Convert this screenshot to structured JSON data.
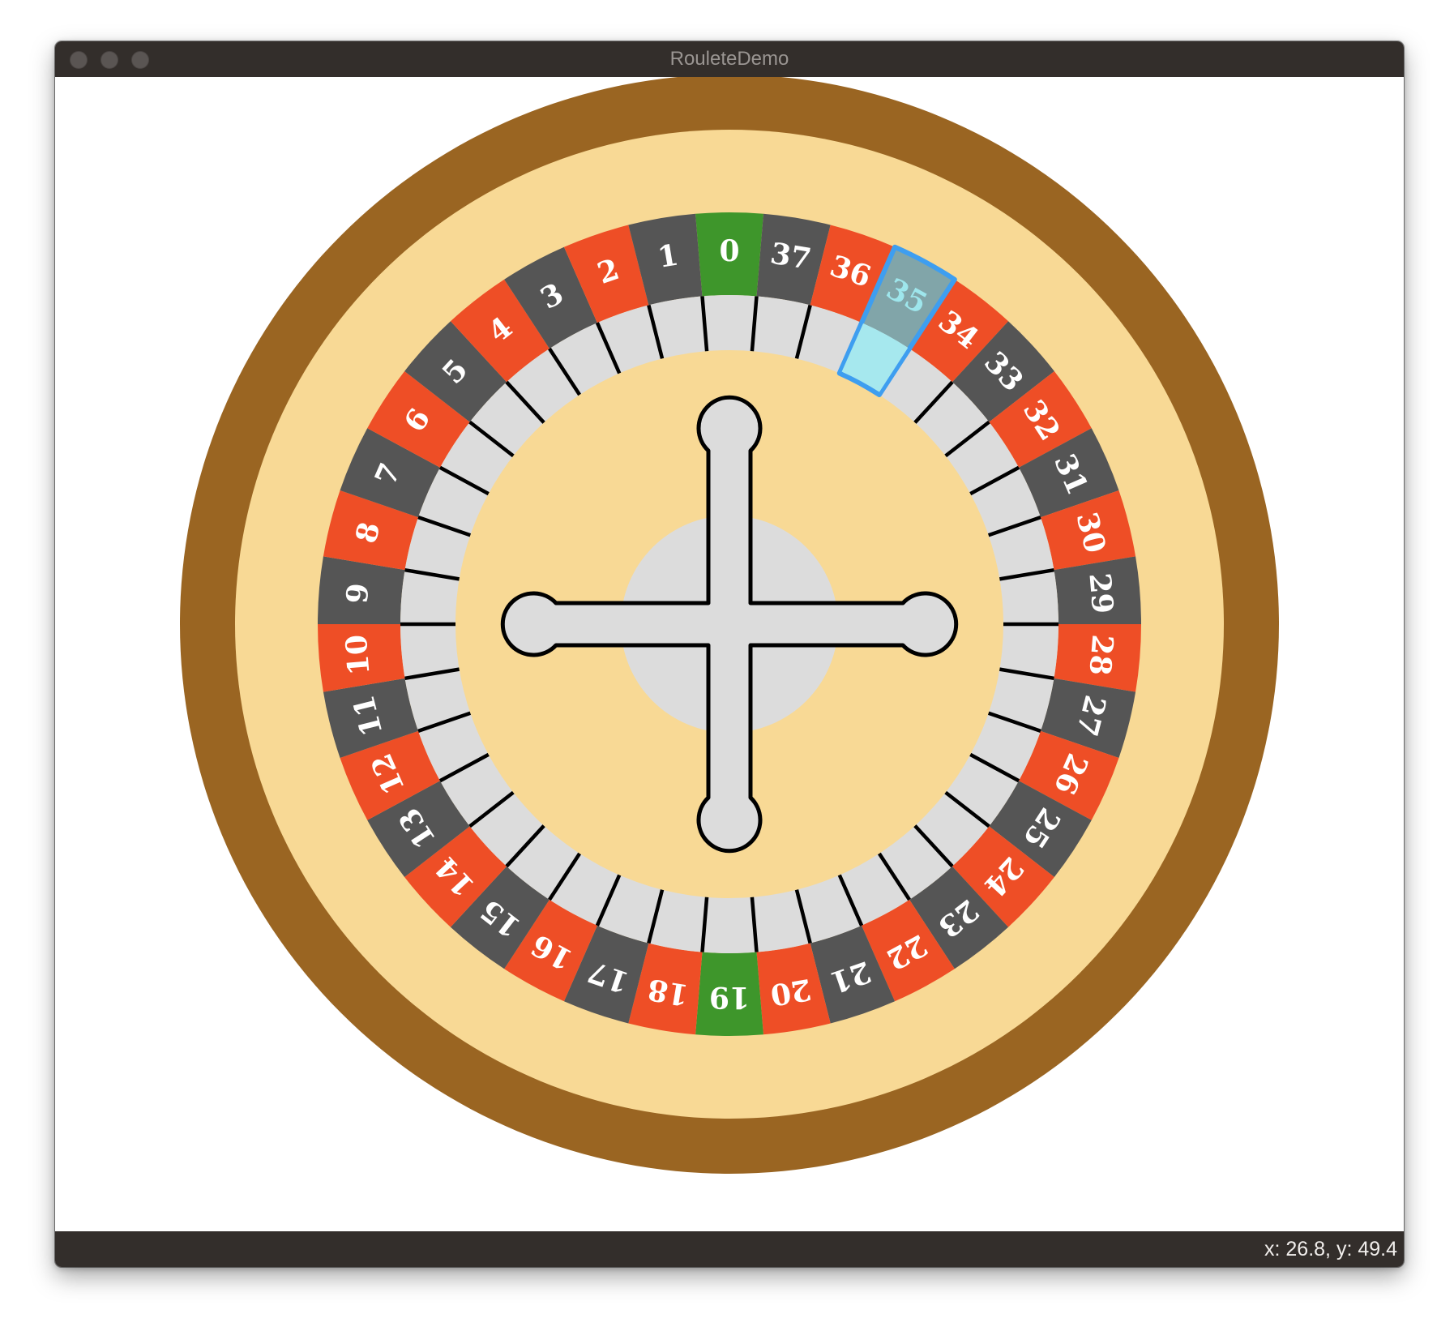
{
  "window": {
    "title": "RouleteDemo"
  },
  "status": {
    "coords": "x: 26.8, y: 49.4"
  },
  "colors": {
    "outer_rim": "#9a6522",
    "tan": "#f8d995",
    "red": "#ee4e26",
    "black": "#555555",
    "green": "#3e962b",
    "divider_track": "#dcdcdc",
    "highlight_fill": "#a6e8ee",
    "highlight_stroke": "#3e9ef0",
    "highlight_text": "#9ee6ec"
  },
  "wheel": {
    "highlighted": "35",
    "pockets": [
      {
        "label": "0",
        "color": "green"
      },
      {
        "label": "37",
        "color": "black"
      },
      {
        "label": "36",
        "color": "red"
      },
      {
        "label": "35",
        "color": "black"
      },
      {
        "label": "34",
        "color": "red"
      },
      {
        "label": "33",
        "color": "black"
      },
      {
        "label": "32",
        "color": "red"
      },
      {
        "label": "31",
        "color": "black"
      },
      {
        "label": "30",
        "color": "red"
      },
      {
        "label": "29",
        "color": "black"
      },
      {
        "label": "28",
        "color": "red"
      },
      {
        "label": "27",
        "color": "black"
      },
      {
        "label": "26",
        "color": "red"
      },
      {
        "label": "25",
        "color": "black"
      },
      {
        "label": "24",
        "color": "red"
      },
      {
        "label": "23",
        "color": "black"
      },
      {
        "label": "22",
        "color": "red"
      },
      {
        "label": "21",
        "color": "black"
      },
      {
        "label": "20",
        "color": "red"
      },
      {
        "label": "19",
        "color": "green"
      },
      {
        "label": "18",
        "color": "red"
      },
      {
        "label": "17",
        "color": "black"
      },
      {
        "label": "16",
        "color": "red"
      },
      {
        "label": "15",
        "color": "black"
      },
      {
        "label": "14",
        "color": "red"
      },
      {
        "label": "13",
        "color": "black"
      },
      {
        "label": "12",
        "color": "red"
      },
      {
        "label": "11",
        "color": "black"
      },
      {
        "label": "10",
        "color": "red"
      },
      {
        "label": "9",
        "color": "black"
      },
      {
        "label": "8",
        "color": "red"
      },
      {
        "label": "7",
        "color": "black"
      },
      {
        "label": "6",
        "color": "red"
      },
      {
        "label": "5",
        "color": "black"
      },
      {
        "label": "4",
        "color": "red"
      },
      {
        "label": "3",
        "color": "black"
      },
      {
        "label": "2",
        "color": "red"
      },
      {
        "label": "1",
        "color": "black"
      }
    ]
  }
}
